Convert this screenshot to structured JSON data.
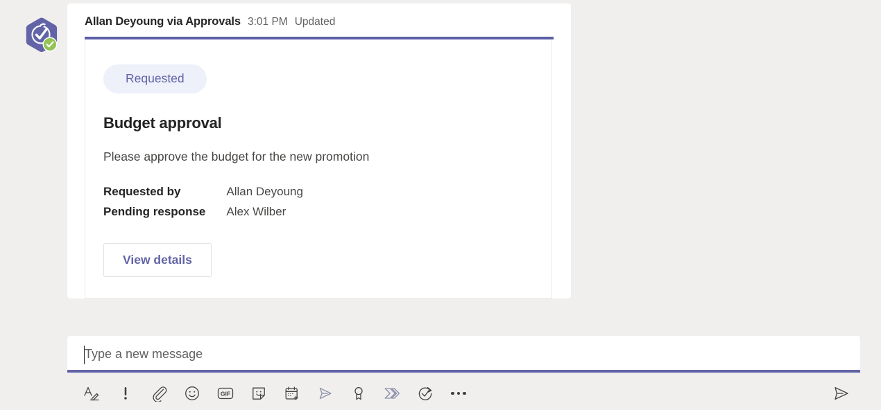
{
  "page": {
    "background": "#f0efee",
    "accent_color": "#6264a7"
  },
  "message": {
    "avatar_icon": "approvals-app-avatar",
    "presence_badge": "available-badge",
    "author": "Allan Deyoung via Approvals",
    "timestamp": "3:01 PM",
    "status": "Updated"
  },
  "card": {
    "accent_color": "#5b5fa7",
    "status_pill": {
      "label": "Requested",
      "background": "#eef0fa",
      "text_color": "#6264a7"
    },
    "title": "Budget approval",
    "description": "Please approve the budget for the new promotion",
    "facts": [
      {
        "label": "Requested by",
        "value": "Allan Deyoung"
      },
      {
        "label": "Pending response",
        "value": "Alex Wilber"
      }
    ],
    "action_button": "View details"
  },
  "compose": {
    "placeholder": "Type a new message",
    "value": "",
    "toolbar": [
      {
        "name": "format-icon",
        "title": "Format"
      },
      {
        "name": "important-icon",
        "title": "Set delivery options"
      },
      {
        "name": "attach-icon",
        "title": "Attach"
      },
      {
        "name": "emoji-icon",
        "title": "Emoji"
      },
      {
        "name": "gif-icon",
        "title": "Giphy"
      },
      {
        "name": "sticker-icon",
        "title": "Sticker"
      },
      {
        "name": "schedule-meeting-icon",
        "title": "Schedule a meeting"
      },
      {
        "name": "stream-icon",
        "title": "Stream"
      },
      {
        "name": "praise-icon",
        "title": "Praise"
      },
      {
        "name": "power-automate-icon",
        "title": "Flow"
      },
      {
        "name": "approvals-icon",
        "title": "Approvals"
      },
      {
        "name": "more-options-icon",
        "title": "More options"
      }
    ],
    "send_icon": {
      "name": "send-icon",
      "title": "Send"
    }
  }
}
